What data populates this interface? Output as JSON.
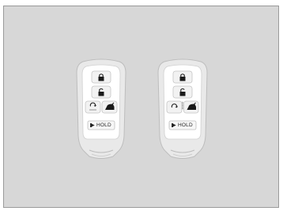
{
  "fobs": [
    {
      "hold_label": "HOLD",
      "buttons": [
        "lock-button",
        "unlock-button",
        "remote-start-button",
        "tailgate-button"
      ]
    },
    {
      "hold_label": "HOLD",
      "buttons": [
        "lock-button",
        "unlock-button",
        "remote-start-button",
        "tailgate-button"
      ]
    }
  ],
  "colors": {
    "panel_bg": "#d7d7d7",
    "fob_outer": "#e9e9e9",
    "fob_inner": "#ffffff",
    "button_face": "#f2f2f2",
    "icon": "#1a1a1a"
  }
}
